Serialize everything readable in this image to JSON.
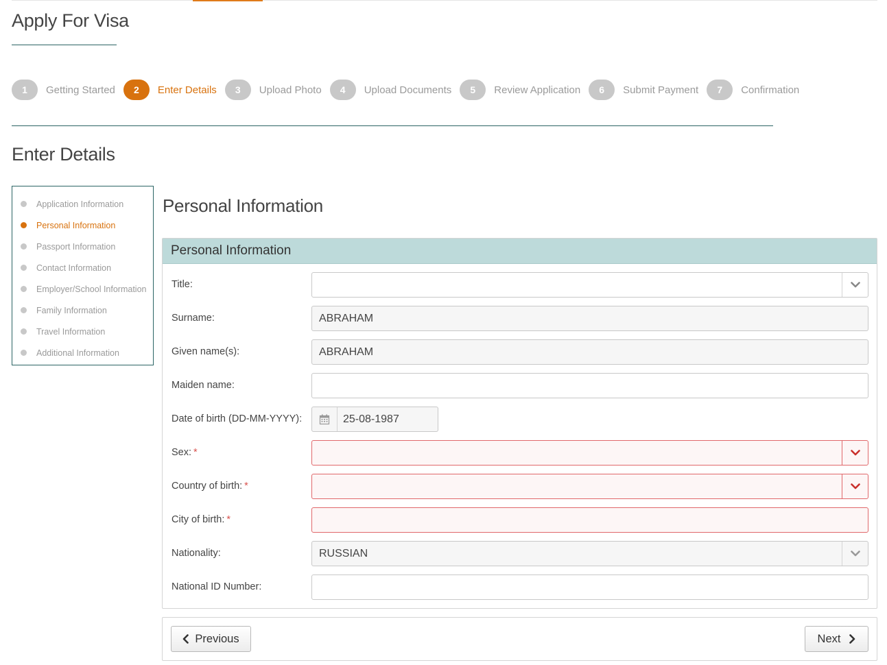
{
  "page": {
    "title": "Apply For Visa"
  },
  "wizard": {
    "steps": [
      {
        "number": "1",
        "label": "Getting Started",
        "active": false
      },
      {
        "number": "2",
        "label": "Enter Details",
        "active": true
      },
      {
        "number": "3",
        "label": "Upload Photo",
        "active": false
      },
      {
        "number": "4",
        "label": "Upload Documents",
        "active": false
      },
      {
        "number": "5",
        "label": "Review Application",
        "active": false
      },
      {
        "number": "6",
        "label": "Submit Payment",
        "active": false
      },
      {
        "number": "7",
        "label": "Confirmation",
        "active": false
      }
    ]
  },
  "section": {
    "title": "Enter Details"
  },
  "sidebar": {
    "items": [
      {
        "label": "Application Information",
        "active": false
      },
      {
        "label": "Personal Information",
        "active": true
      },
      {
        "label": "Passport Information",
        "active": false
      },
      {
        "label": "Contact Information",
        "active": false
      },
      {
        "label": "Employer/School Information",
        "active": false
      },
      {
        "label": "Family Information",
        "active": false
      },
      {
        "label": "Travel Information",
        "active": false
      },
      {
        "label": "Additional Information",
        "active": false
      }
    ]
  },
  "content": {
    "title": "Personal Information"
  },
  "form": {
    "panel_title": "Personal Information",
    "fields": {
      "title": {
        "label": "Title:",
        "value": ""
      },
      "surname": {
        "label": "Surname:",
        "value": "ABRAHAM"
      },
      "given_names": {
        "label": "Given name(s):",
        "value": "ABRAHAM"
      },
      "maiden_name": {
        "label": "Maiden name:",
        "value": ""
      },
      "dob": {
        "label": "Date of birth (DD-MM-YYYY):",
        "value": "25-08-1987"
      },
      "sex": {
        "label": "Sex:",
        "required": "*",
        "value": ""
      },
      "country_of_birth": {
        "label": "Country of birth:",
        "required": "*",
        "value": ""
      },
      "city_of_birth": {
        "label": "City of birth:",
        "required": "*",
        "value": ""
      },
      "nationality": {
        "label": "Nationality:",
        "value": "RUSSIAN"
      },
      "national_id": {
        "label": "National ID Number:",
        "value": ""
      }
    }
  },
  "navigation": {
    "previous_label": "Previous",
    "next_label": "Next"
  },
  "colors": {
    "accent": "#d8720e",
    "teal": "#2a6363",
    "panel_header": "#bddada",
    "error": "#e0676a"
  },
  "icons": [
    "calendar-icon",
    "chevron-down-icon",
    "chevron-left-icon",
    "chevron-right-icon"
  ]
}
